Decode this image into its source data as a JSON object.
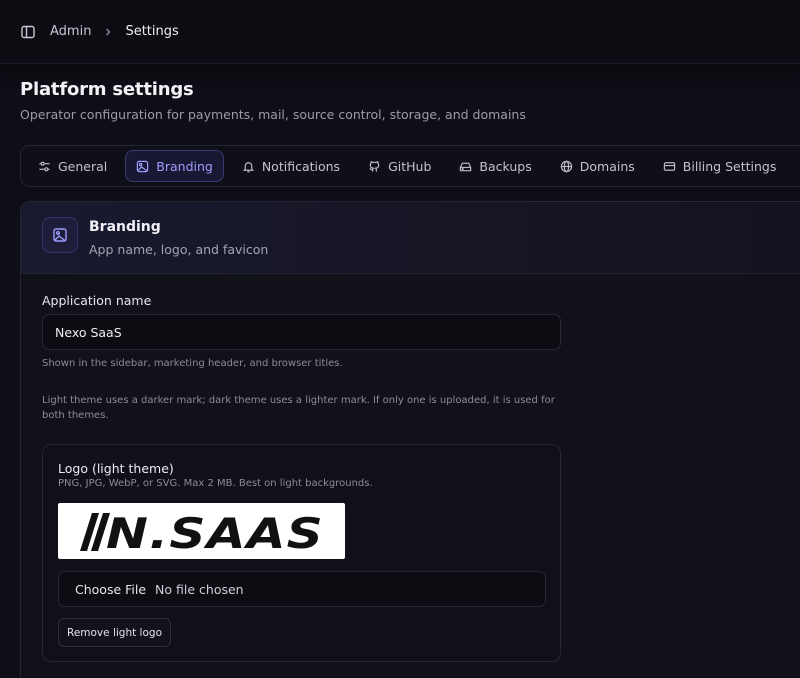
{
  "breadcrumb": {
    "root": "Admin",
    "current": "Settings"
  },
  "page": {
    "title": "Platform settings",
    "subtitle": "Operator configuration for payments, mail, source control, storage, and domains"
  },
  "tabs": [
    {
      "label": "General",
      "icon": "sliders-icon"
    },
    {
      "label": "Branding",
      "icon": "image-icon",
      "active": true
    },
    {
      "label": "Notifications",
      "icon": "bell-icon"
    },
    {
      "label": "GitHub",
      "icon": "github-icon"
    },
    {
      "label": "Backups",
      "icon": "hard-drive-icon"
    },
    {
      "label": "Domains",
      "icon": "globe-icon"
    },
    {
      "label": "Billing Settings",
      "icon": "credit-card-icon"
    }
  ],
  "branding": {
    "title": "Branding",
    "subtitle": "App name, logo, and favicon",
    "app_name_label": "Application name",
    "app_name_value": "Nexo SaaS",
    "app_name_help": "Shown in the sidebar, marketing header, and browser titles.",
    "theme_help": "Light theme uses a darker mark; dark theme uses a lighter mark. If only one is uploaded, it is used for both themes.",
    "logo_light": {
      "title": "Logo (light theme)",
      "help": "PNG, JPG, WebP, or SVG. Max 2 MB. Best on light backgrounds.",
      "preview_text": "N.SAAS",
      "choose_label": "Choose File",
      "no_file_label": "No file chosen",
      "remove_label": "Remove light logo"
    }
  },
  "colors": {
    "accent": "#8b8bff",
    "background": "#0e0e16"
  }
}
